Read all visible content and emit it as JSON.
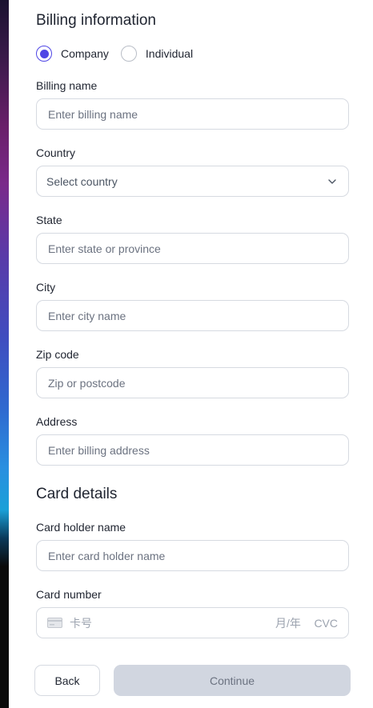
{
  "billing": {
    "title": "Billing information",
    "account_type": {
      "options": [
        "Company",
        "Individual"
      ],
      "selected": "Company"
    },
    "fields": {
      "billing_name": {
        "label": "Billing name",
        "placeholder": "Enter billing name",
        "value": ""
      },
      "country": {
        "label": "Country",
        "selected_value": "Select country"
      },
      "state": {
        "label": "State",
        "placeholder": "Enter state or province",
        "value": ""
      },
      "city": {
        "label": "City",
        "placeholder": "Enter city name",
        "value": ""
      },
      "zip": {
        "label": "Zip code",
        "placeholder": "Zip or postcode",
        "value": ""
      },
      "address": {
        "label": "Address",
        "placeholder": "Enter billing address",
        "value": ""
      }
    }
  },
  "card": {
    "title": "Card details",
    "holder": {
      "label": "Card holder name",
      "placeholder": "Enter card holder name",
      "value": ""
    },
    "number": {
      "label": "Card number",
      "placeholder": "卡号",
      "expiry_placeholder": "月/年",
      "cvc_placeholder": "CVC"
    }
  },
  "actions": {
    "back_label": "Back",
    "continue_label": "Continue",
    "continue_disabled": true
  },
  "icons": {
    "country_dropdown": "chevron-down-icon",
    "card_number": "credit-card-icon"
  },
  "colors": {
    "accent": "#4f46e5",
    "disabled_button_bg": "#d1d6e0",
    "border": "#d6dae1"
  }
}
